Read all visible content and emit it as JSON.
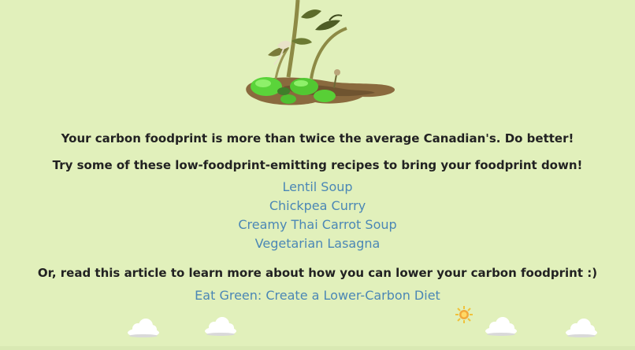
{
  "result": {
    "message": "Your carbon foodprint is more than twice the average Canadian's. Do better!",
    "suggestion": "Try some of these low-foodprint-emitting recipes to bring your foodprint down!"
  },
  "recipes": [
    {
      "label": "Lentil Soup"
    },
    {
      "label": "Chickpea Curry"
    },
    {
      "label": "Creamy Thai Carrot Soup"
    },
    {
      "label": "Vegetarian Lasagna"
    }
  ],
  "article": {
    "prompt": "Or, read this article to learn more about how you can lower your carbon foodprint :)",
    "link_label": "Eat Green: Create a Lower-Carbon Diet"
  },
  "icons": {
    "illustration": "wilted-plant-in-mud-illustration",
    "sun": "sun-icon",
    "clouds": "cloud-icon"
  },
  "colors": {
    "background": "#e1f0bb",
    "link": "#4b87b5",
    "text": "#222222"
  }
}
